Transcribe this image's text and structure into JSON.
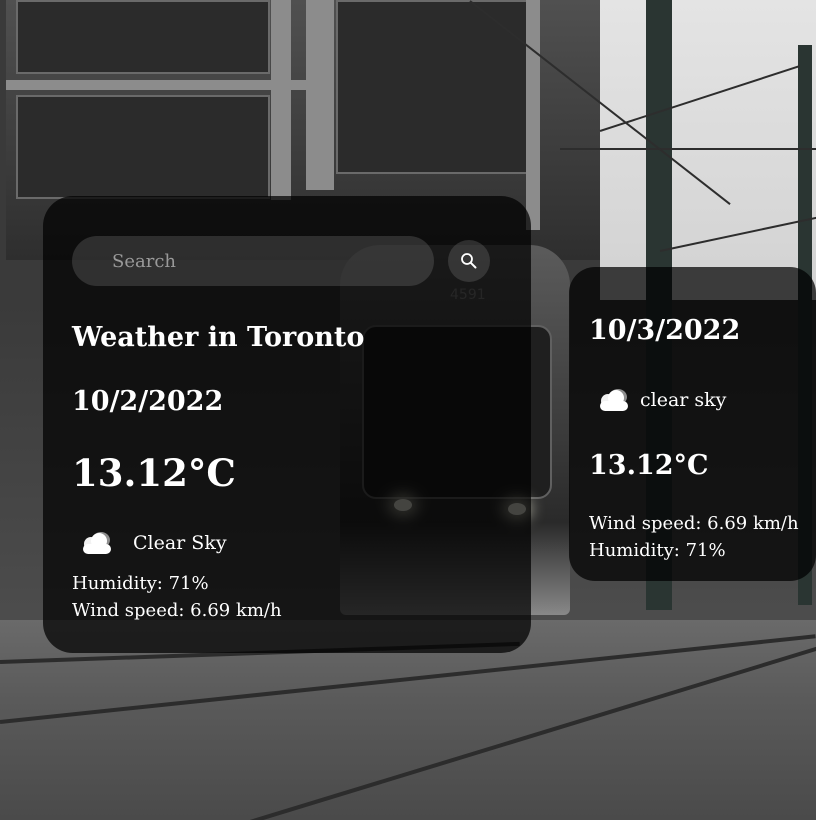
{
  "search": {
    "placeholder": "Search"
  },
  "current": {
    "title": "Weather in Toronto",
    "date": "10/2/2022",
    "temperature": "13.12°C",
    "condition": "Clear Sky",
    "condition_icon": "cloud-icon",
    "humidity": "Humidity: 71%",
    "wind": "Wind speed: 6.69 km/h"
  },
  "forecast": {
    "date": "10/3/2022",
    "condition": "clear sky",
    "condition_icon": "cloud-icon",
    "temperature": "13.12°C",
    "wind": "Wind speed: 6.69 km/h",
    "humidity": "Humidity: 71%"
  },
  "background": {
    "tram_number": "4591"
  },
  "colors": {
    "card": "#000000b8",
    "text": "#ffffff",
    "placeholder": "#9a9a9a"
  }
}
